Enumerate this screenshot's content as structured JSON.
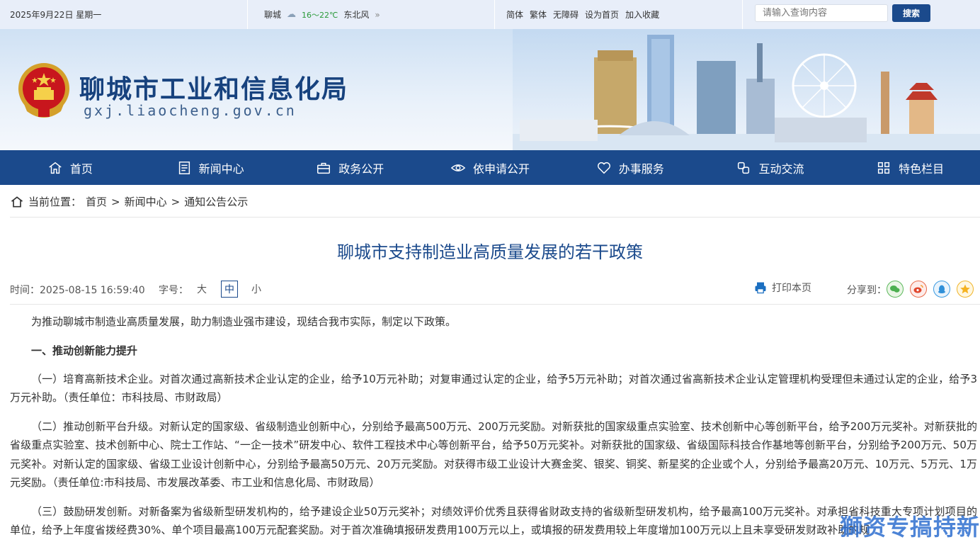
{
  "topbar": {
    "date": "2025年9月22日 星期一",
    "city": "聊城",
    "weather_icon": "rain-cloud-icon",
    "temperature": "16～22℃",
    "wind": "东北风",
    "links": [
      "简体",
      "繁体",
      "无障碍",
      "设为首页",
      "加入收藏"
    ],
    "search_placeholder": "请输入查询内容",
    "search_button": "搜索"
  },
  "banner": {
    "title": "聊城市工业和信息化局",
    "url": "gxj.liaocheng.gov.cn"
  },
  "nav": [
    {
      "label": "首页",
      "icon": "home-icon"
    },
    {
      "label": "新闻中心",
      "icon": "document-icon"
    },
    {
      "label": "政务公开",
      "icon": "briefcase-icon"
    },
    {
      "label": "依申请公开",
      "icon": "eye-icon"
    },
    {
      "label": "办事服务",
      "icon": "heart-icon"
    },
    {
      "label": "互动交流",
      "icon": "exchange-icon"
    },
    {
      "label": "特色栏目",
      "icon": "grid-icon"
    }
  ],
  "breadcrumb": {
    "prefix": "当前位置：",
    "items": [
      "首页",
      "新闻中心",
      "通知公告公示"
    ],
    "separator": ">"
  },
  "article": {
    "title": "聊城市支持制造业高质量发展的若干政策",
    "time": "时间：2025-08-15 16:59:40",
    "font_size_label": "字号：",
    "font_sizes": [
      "大",
      "中",
      "小"
    ],
    "print_label": "打印本页",
    "share_label": "分享到：",
    "share_icons": [
      "wechat-icon",
      "weibo-icon",
      "qq-icon",
      "qzone-icon"
    ],
    "intro": "为推动聊城市制造业高质量发展，助力制造业强市建设，现结合我市实际，制定以下政策。",
    "section1": "一、推动创新能力提升",
    "para1": "（一）培育高新技术企业。对首次通过高新技术企业认定的企业，给予10万元补助；对复审通过认定的企业，给予5万元补助；对首次通过省高新技术企业认定管理机构受理但未通过认定的企业，给予3万元补助。（责任单位：市科技局、市财政局）",
    "para2": "（二）推动创新平台升级。对新认定的国家级、省级制造业创新中心，分别给予最高500万元、200万元奖励。对新获批的国家级重点实验室、技术创新中心等创新平台，给予200万元奖补。对新获批的省级重点实验室、技术创新中心、院士工作站、“一企一技术”研发中心、软件工程技术中心等创新平台，给予50万元奖补。对新获批的国家级、省级国际科技合作基地等创新平台，分别给予200万元、50万元奖补。对新认定的国家级、省级工业设计创新中心，分别给予最高50万元、20万元奖励。对获得市级工业设计大赛金奖、银奖、铜奖、新星奖的企业或个人，分别给予最高20万元、10万元、5万元、1万元奖励。（责任单位:市科技局、市发展改革委、市工业和信息化局、市财政局）",
    "para3": "（三）鼓励研发创新。对新备案为省级新型研发机构的，给予建设企业50万元奖补；对绩效评价优秀且获得省财政支持的省级新型研发机构，给予最高100万元奖补。对承担省科技重大专项计划项目的单位，给予上年度省拨经费30%、单个项目最高100万元配套奖励。对于首次准确填报研发费用100万元以上，或填报的研发费用较上年度增加100万元以上且未享受研发财政补助的规"
  },
  "watermark": "獅资专搞持新"
}
